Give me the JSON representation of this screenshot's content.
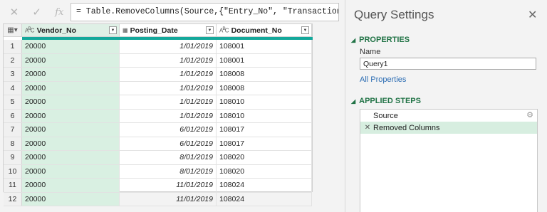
{
  "formula_bar": {
    "cancel_icon": "✕",
    "commit_icon": "✓",
    "fx_label": "fx",
    "formula": "= Table.RemoveColumns(Source,{\"Entry_No\", \"Transaction_No\","
  },
  "grid": {
    "corner_icon": "table-menu-icon",
    "columns": [
      {
        "label": "Vendor_No",
        "type_icon": "ABC"
      },
      {
        "label": "Posting_Date",
        "type_icon": "calendar"
      },
      {
        "label": "Document_No",
        "type_icon": "ABC"
      }
    ],
    "rows": [
      {
        "n": "1",
        "vendor": "20000",
        "date": "1/01/2019",
        "doc": "108001"
      },
      {
        "n": "2",
        "vendor": "20000",
        "date": "1/01/2019",
        "doc": "108001"
      },
      {
        "n": "3",
        "vendor": "20000",
        "date": "1/01/2019",
        "doc": "108008"
      },
      {
        "n": "4",
        "vendor": "20000",
        "date": "1/01/2019",
        "doc": "108008"
      },
      {
        "n": "5",
        "vendor": "20000",
        "date": "1/01/2019",
        "doc": "108010"
      },
      {
        "n": "6",
        "vendor": "20000",
        "date": "1/01/2019",
        "doc": "108010"
      },
      {
        "n": "7",
        "vendor": "20000",
        "date": "6/01/2019",
        "doc": "108017"
      },
      {
        "n": "8",
        "vendor": "20000",
        "date": "6/01/2019",
        "doc": "108017"
      },
      {
        "n": "9",
        "vendor": "20000",
        "date": "8/01/2019",
        "doc": "108020"
      },
      {
        "n": "10",
        "vendor": "20000",
        "date": "8/01/2019",
        "doc": "108020"
      },
      {
        "n": "11",
        "vendor": "20000",
        "date": "11/01/2019",
        "doc": "108024"
      },
      {
        "n": "12",
        "vendor": "20000",
        "date": "11/01/2019",
        "doc": "108024"
      }
    ]
  },
  "query_settings": {
    "title": "Query Settings",
    "close_icon": "✕",
    "properties_title": "PROPERTIES",
    "name_label": "Name",
    "name_value": "Query1",
    "all_properties_label": "All Properties",
    "applied_steps_title": "APPLIED STEPS",
    "steps": [
      {
        "label": "Source",
        "has_gear": true
      },
      {
        "label": "Removed Columns",
        "has_gear": false
      }
    ]
  },
  "colors": {
    "accent_green": "#217346",
    "selected_column": "#d9f0e2",
    "teal_strip": "#14a89b",
    "link_blue": "#2b6cb3"
  }
}
